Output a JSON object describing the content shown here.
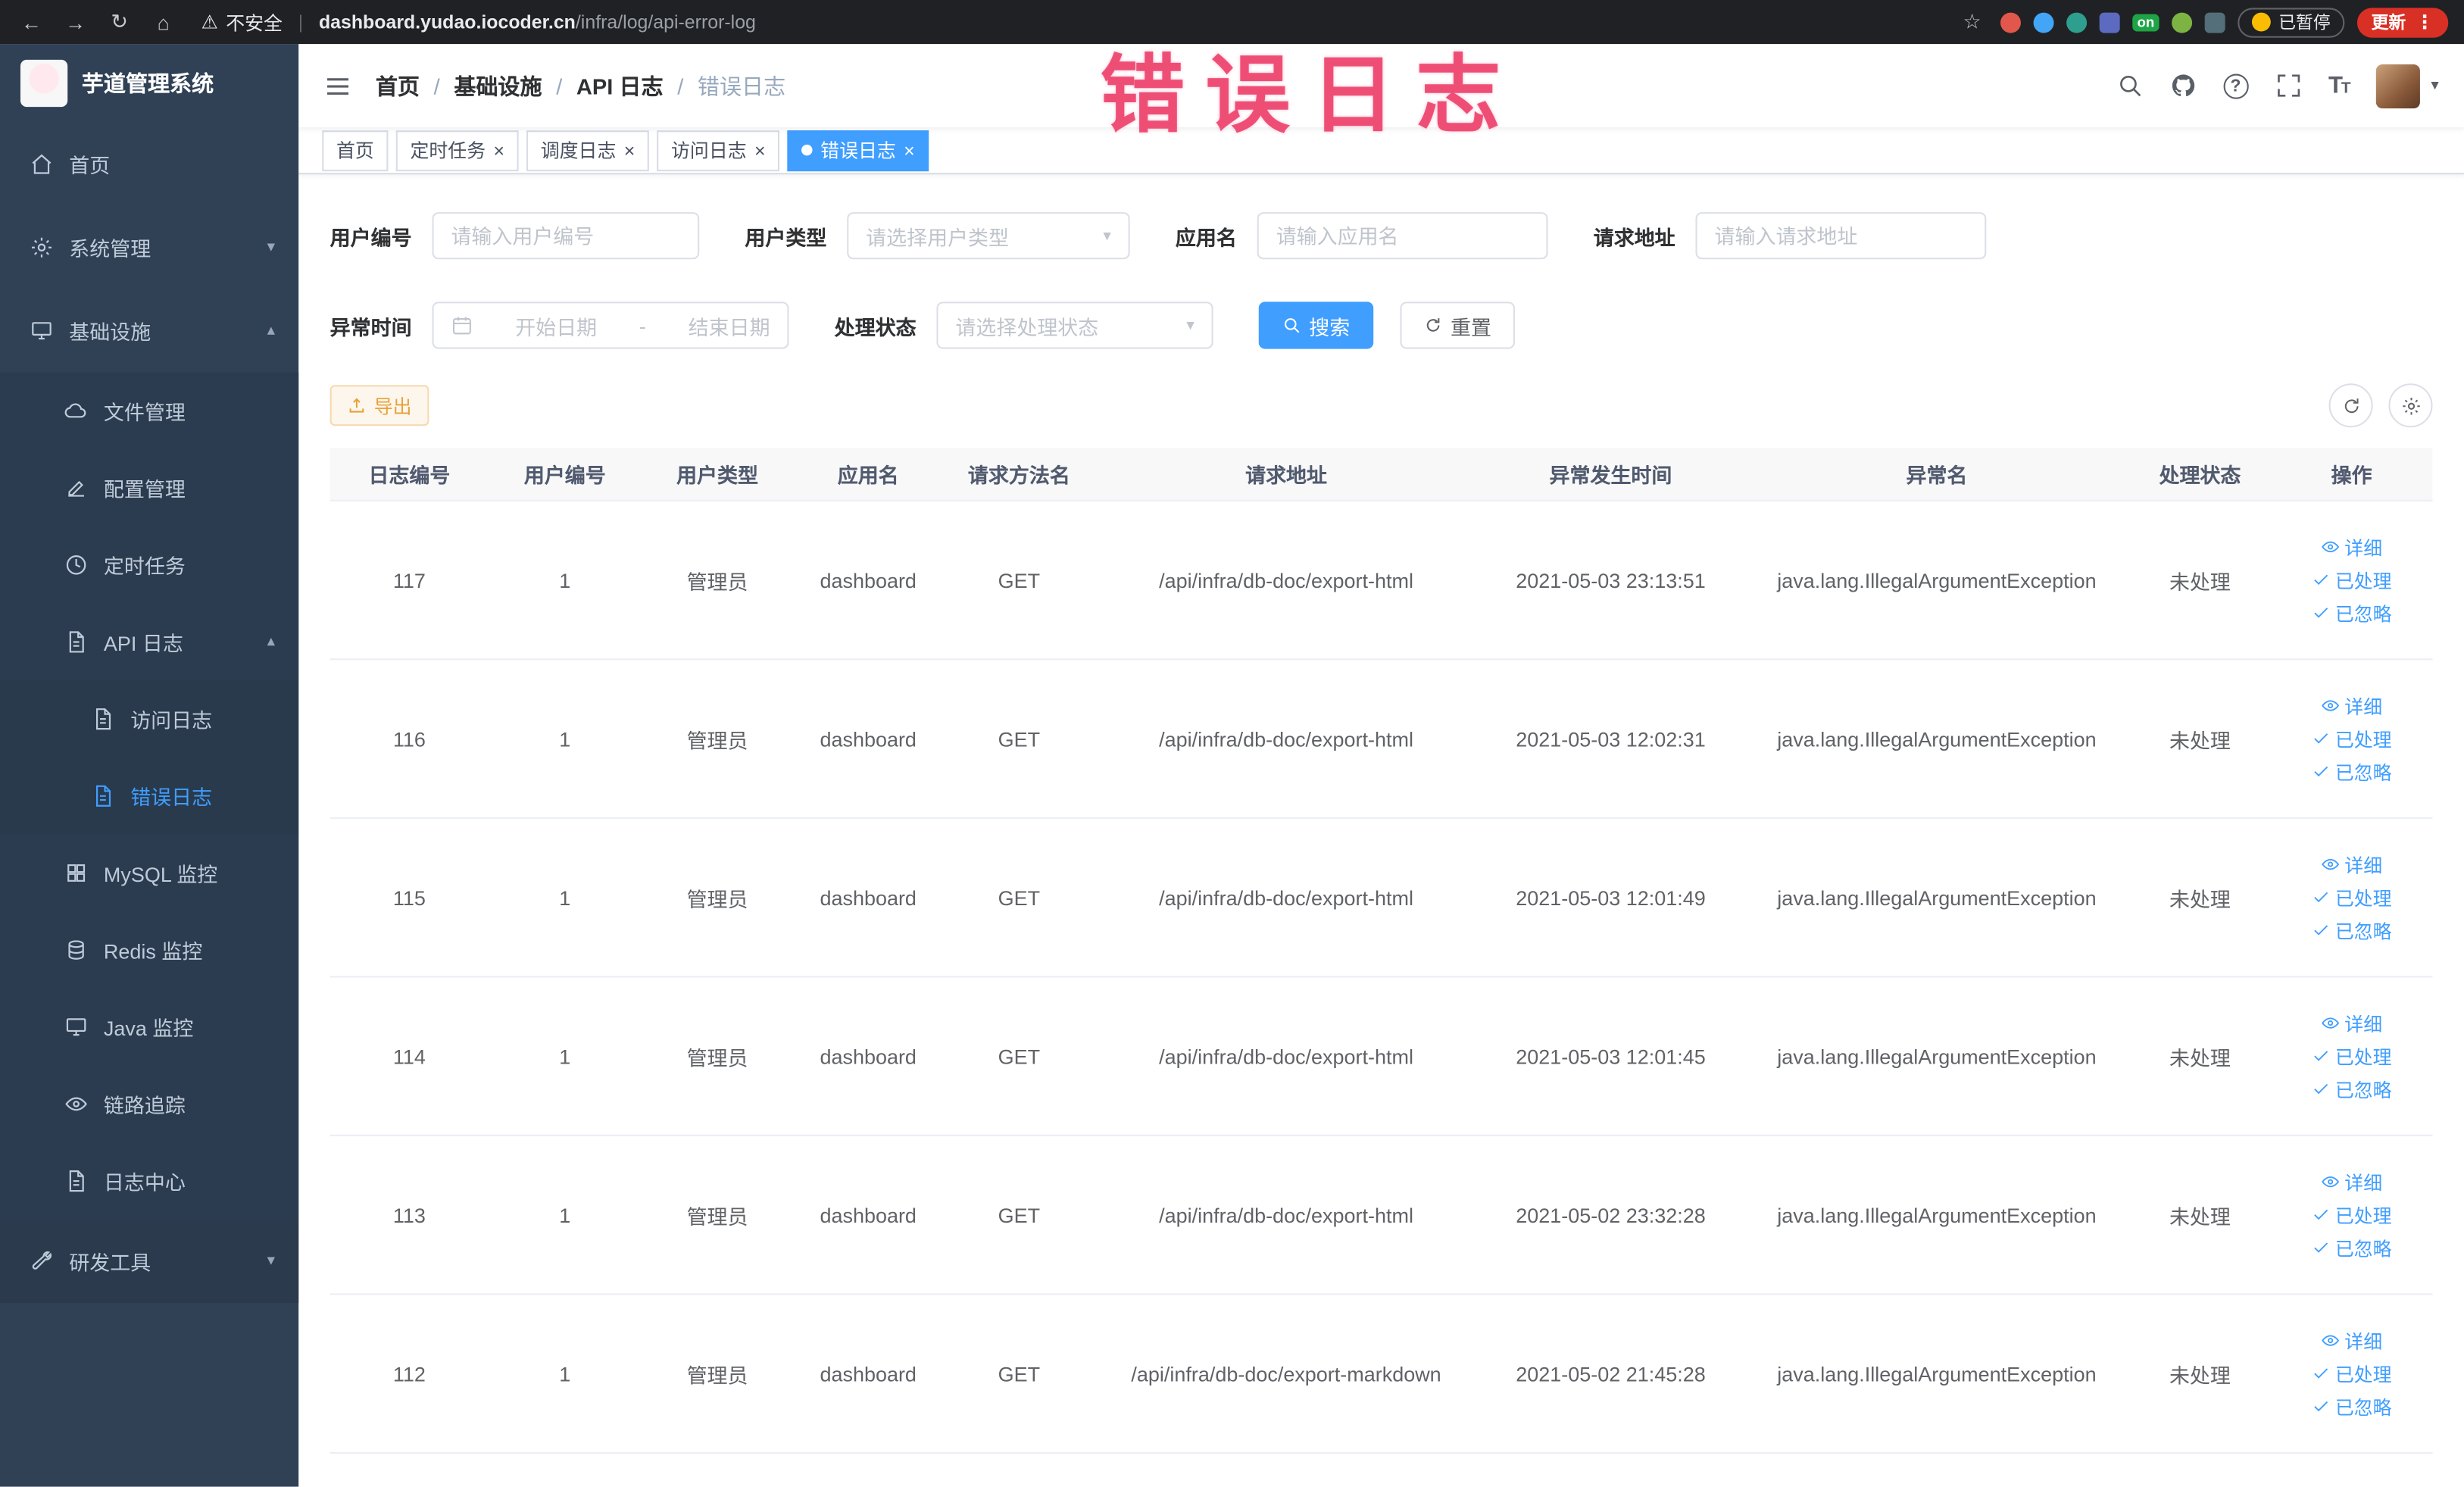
{
  "browser": {
    "security_label": "不安全",
    "url_host": "dashboard.yudao.iocoder.cn",
    "url_path": "/infra/log/api-error-log",
    "ext_on_badge": "on",
    "paused_label": "已暂停",
    "update_label": "更新"
  },
  "overlay_title": "错误日志",
  "sidebar": {
    "logo_title": "芋道管理系统",
    "menu": {
      "home": "首页",
      "system": "系统管理",
      "infra": "基础设施",
      "file": "文件管理",
      "config": "配置管理",
      "job": "定时任务",
      "api_log": "API 日志",
      "access_log": "访问日志",
      "error_log": "错误日志",
      "mysql": "MySQL 监控",
      "redis": "Redis 监控",
      "java": "Java 监控",
      "trace": "链路追踪",
      "log_center": "日志中心",
      "dev_tools": "研发工具"
    }
  },
  "header": {
    "breadcrumb": [
      "首页",
      "基础设施",
      "API 日志",
      "错误日志"
    ]
  },
  "tabs": [
    {
      "label": "首页"
    },
    {
      "label": "定时任务"
    },
    {
      "label": "调度日志"
    },
    {
      "label": "访问日志"
    },
    {
      "label": "错误日志"
    }
  ],
  "filters": {
    "user_id": {
      "label": "用户编号",
      "placeholder": "请输入用户编号"
    },
    "user_type": {
      "label": "用户类型",
      "placeholder": "请选择用户类型"
    },
    "app_name": {
      "label": "应用名",
      "placeholder": "请输入应用名"
    },
    "request_url": {
      "label": "请求地址",
      "placeholder": "请输入请求地址"
    },
    "exception_time": {
      "label": "异常时间",
      "start_placeholder": "开始日期",
      "separator": "-",
      "end_placeholder": "结束日期"
    },
    "process_status": {
      "label": "处理状态",
      "placeholder": "请选择处理状态"
    },
    "search_label": "搜索",
    "reset_label": "重置"
  },
  "toolbar": {
    "export_label": "导出"
  },
  "table": {
    "columns": [
      "日志编号",
      "用户编号",
      "用户类型",
      "应用名",
      "请求方法名",
      "请求地址",
      "异常发生时间",
      "异常名",
      "处理状态",
      "操作"
    ],
    "action_labels": {
      "detail": "详细",
      "processed": "已处理",
      "ignored": "已忽略"
    },
    "rows": [
      {
        "id": "117",
        "user_id": "1",
        "user_type": "管理员",
        "app_name": "dashboard",
        "method": "GET",
        "url": "/api/infra/db-doc/export-html",
        "time": "2021-05-03 23:13:51",
        "exception": "java.lang.IllegalArgumentException",
        "status": "未处理"
      },
      {
        "id": "116",
        "user_id": "1",
        "user_type": "管理员",
        "app_name": "dashboard",
        "method": "GET",
        "url": "/api/infra/db-doc/export-html",
        "time": "2021-05-03 12:02:31",
        "exception": "java.lang.IllegalArgumentException",
        "status": "未处理"
      },
      {
        "id": "115",
        "user_id": "1",
        "user_type": "管理员",
        "app_name": "dashboard",
        "method": "GET",
        "url": "/api/infra/db-doc/export-html",
        "time": "2021-05-03 12:01:49",
        "exception": "java.lang.IllegalArgumentException",
        "status": "未处理"
      },
      {
        "id": "114",
        "user_id": "1",
        "user_type": "管理员",
        "app_name": "dashboard",
        "method": "GET",
        "url": "/api/infra/db-doc/export-html",
        "time": "2021-05-03 12:01:45",
        "exception": "java.lang.IllegalArgumentException",
        "status": "未处理"
      },
      {
        "id": "113",
        "user_id": "1",
        "user_type": "管理员",
        "app_name": "dashboard",
        "method": "GET",
        "url": "/api/infra/db-doc/export-html",
        "time": "2021-05-02 23:32:28",
        "exception": "java.lang.IllegalArgumentException",
        "status": "未处理"
      },
      {
        "id": "112",
        "user_id": "1",
        "user_type": "管理员",
        "app_name": "dashboard",
        "method": "GET",
        "url": "/api/infra/db-doc/export-markdown",
        "time": "2021-05-02 21:45:28",
        "exception": "java.lang.IllegalArgumentException",
        "status": "未处理"
      }
    ]
  }
}
